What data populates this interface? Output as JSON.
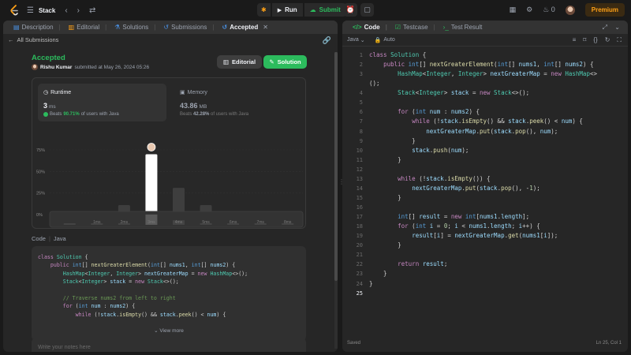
{
  "topbar": {
    "problem_title": "Stack",
    "run_label": "Run",
    "submit_label": "Submit",
    "streak_count": "0",
    "premium_label": "Premium"
  },
  "left_tabs": [
    {
      "label": "Description"
    },
    {
      "label": "Editorial"
    },
    {
      "label": "Solutions"
    },
    {
      "label": "Submissions"
    },
    {
      "label": "Accepted"
    }
  ],
  "submission": {
    "back_label": "All Submissions",
    "status": "Accepted",
    "user": "Rishu Kumar",
    "submitted_text": "submitted at May 26, 2024 05:26",
    "editorial_btn": "Editorial",
    "solution_btn": "Solution"
  },
  "runtime": {
    "label": "Runtime",
    "value": "3",
    "unit": "ms",
    "beats_prefix": "Beats",
    "beats_pct": "90.71%",
    "beats_suffix": "of users with Java"
  },
  "memory": {
    "label": "Memory",
    "value": "43.86",
    "unit": "MB",
    "beats_prefix": "Beats",
    "beats_pct": "42.28%",
    "beats_suffix": "of users with Java"
  },
  "chart_data": {
    "type": "bar",
    "categories": [
      "",
      "1ms",
      "2ms",
      "3ms",
      "4ms",
      "5ms",
      "6ms",
      "7ms",
      "8ms"
    ],
    "values": [
      3,
      3,
      11,
      70,
      31,
      11,
      3,
      3,
      3
    ],
    "highlight_index": 3,
    "ylim": [
      0,
      75
    ],
    "yticks": [
      "75%",
      "50%",
      "25%",
      "0%"
    ],
    "ytick_values": [
      75,
      50,
      25,
      0
    ],
    "mini_labels": [
      "",
      "1ms",
      "2ms",
      "3ms",
      "4ms",
      "5ms",
      "6ms",
      "7ms",
      "8ms"
    ],
    "colors": {
      "bar": "#3e3e3e",
      "highlight": "#ffffff",
      "label": "#8a8a8a"
    }
  },
  "code_section": {
    "label": "Code",
    "lang": "Java",
    "view_more": "View more",
    "notes_placeholder": "Write your notes here",
    "preview_lines": [
      "class Solution {",
      "    public int[] nextGreaterElement(int[] nums1, int[] nums2) {",
      "        HashMap<Integer, Integer> nextGreaterMap = new HashMap<>();",
      "        Stack<Integer> stack = new Stack<>();",
      "",
      "        // Traverse nums2 from left to right",
      "        for (int num : nums2) {",
      "            while (!stack.isEmpty() && stack.peek() < num) {"
    ]
  },
  "editor": {
    "tabs": [
      {
        "label": "Code"
      },
      {
        "label": "Testcase"
      },
      {
        "label": "Test Result"
      }
    ],
    "language": "Java",
    "mode": "Auto",
    "saved_label": "Saved",
    "cursor_pos": "Ln 25, Col 1",
    "lines": [
      "class Solution {",
      "    public int[] nextGreaterElement(int[] nums1, int[] nums2) {",
      "        HashMap<Integer, Integer> nextGreaterMap = new HashMap<>",
      "();",
      "        Stack<Integer> stack = new Stack<>();",
      "",
      "        for (int num : nums2) {",
      "            while (!stack.isEmpty() && stack.peek() < num) {",
      "                nextGreaterMap.put(stack.pop(), num);",
      "            }",
      "            stack.push(num);",
      "        }",
      "",
      "        while (!stack.isEmpty()) {",
      "            nextGreaterMap.put(stack.pop(), -1);",
      "        }",
      "",
      "        int[] result = new int[nums1.length];",
      "        for (int i = 0; i < nums1.length; i++) {",
      "            result[i] = nextGreaterMap.get(nums1[i]);",
      "        }",
      "",
      "        return result;",
      "    }",
      "}",
      ""
    ],
    "gutter": [
      "1",
      "2",
      "3",
      "",
      "4",
      "5",
      "6",
      "7",
      "8",
      "9",
      "10",
      "11",
      "12",
      "13",
      "14",
      "15",
      "16",
      "17",
      "18",
      "19",
      "20",
      "21",
      "22",
      "23",
      "24",
      "25"
    ]
  }
}
